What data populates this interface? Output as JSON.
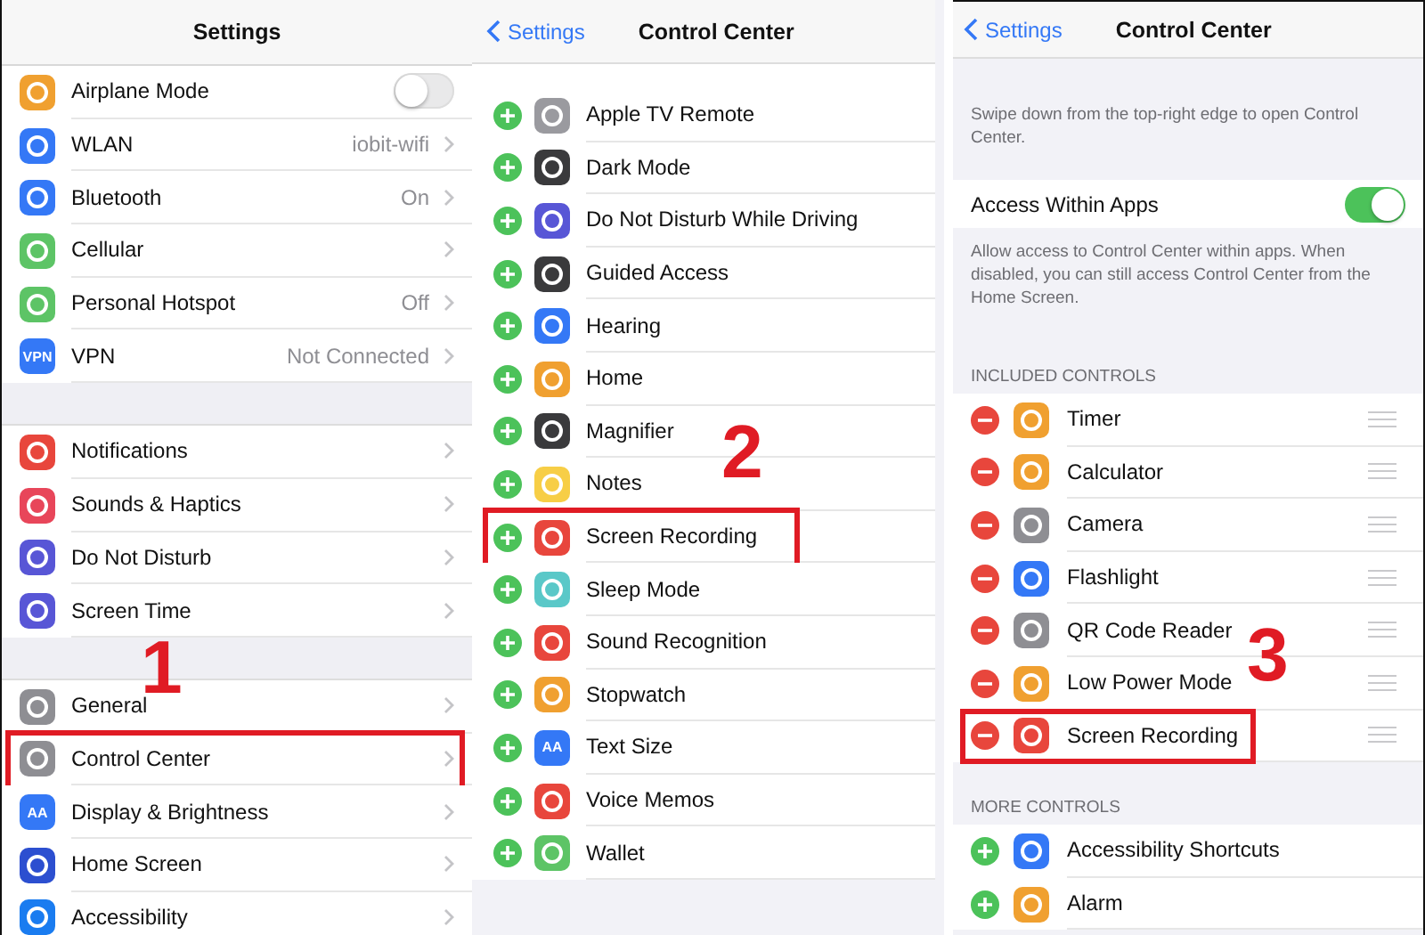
{
  "settings_panel": {
    "title": "Settings",
    "step": "1",
    "groups": [
      [
        {
          "label": "Airplane Mode",
          "kind": "toggle",
          "on": false,
          "color": "#f0a030",
          "highlighted": false
        },
        {
          "label": "WLAN",
          "kind": "link",
          "value": "iobit-wifi",
          "color": "#3478f6",
          "highlighted": false
        },
        {
          "label": "Bluetooth",
          "kind": "link",
          "value": "On",
          "color": "#3478f6",
          "highlighted": false
        },
        {
          "label": "Cellular",
          "kind": "link",
          "color": "#5dc466",
          "highlighted": false
        },
        {
          "label": "Personal Hotspot",
          "kind": "link",
          "value": "Off",
          "color": "#5dc466",
          "highlighted": false
        },
        {
          "label": "VPN",
          "kind": "link",
          "value": "Not Connected",
          "color": "#3478f6",
          "icon_text": "VPN",
          "highlighted": false
        }
      ],
      [
        {
          "label": "Notifications",
          "kind": "link",
          "color": "#e8463c",
          "highlighted": false
        },
        {
          "label": "Sounds & Haptics",
          "kind": "link",
          "color": "#e8465a",
          "highlighted": false
        },
        {
          "label": "Do Not Disturb",
          "kind": "link",
          "color": "#5856d6",
          "highlighted": false
        },
        {
          "label": "Screen Time",
          "kind": "link",
          "color": "#5856d6",
          "highlighted": false
        }
      ],
      [
        {
          "label": "General",
          "kind": "link",
          "color": "#8e8e93",
          "highlighted": false
        },
        {
          "label": "Control Center",
          "kind": "link",
          "color": "#8e8e93",
          "highlighted": true
        },
        {
          "label": "Display & Brightness",
          "kind": "link",
          "color": "#3478f6",
          "icon_text": "AA",
          "highlighted": false
        },
        {
          "label": "Home Screen",
          "kind": "link",
          "color": "#2c4fd0",
          "highlighted": false
        },
        {
          "label": "Accessibility",
          "kind": "link",
          "color": "#1a7cf0",
          "highlighted": false
        }
      ]
    ]
  },
  "more_controls_panel": {
    "back": "Settings",
    "title": "Control Center",
    "step": "2",
    "rows": [
      {
        "label": "Apple TV Remote",
        "color": "#9a9a9f",
        "highlighted": false
      },
      {
        "label": "Dark Mode",
        "color": "#3a3a3c",
        "highlighted": false
      },
      {
        "label": "Do Not Disturb While Driving",
        "color": "#5856d6",
        "highlighted": false
      },
      {
        "label": "Guided Access",
        "color": "#3a3a3c",
        "highlighted": false
      },
      {
        "label": "Hearing",
        "color": "#3478f6",
        "highlighted": false
      },
      {
        "label": "Home",
        "color": "#f0a030",
        "highlighted": false
      },
      {
        "label": "Magnifier",
        "color": "#3a3a3c",
        "highlighted": false
      },
      {
        "label": "Notes",
        "color": "#f7ce46",
        "highlighted": false
      },
      {
        "label": "Screen Recording",
        "color": "#e8463c",
        "highlighted": true
      },
      {
        "label": "Sleep Mode",
        "color": "#5ac8c8",
        "highlighted": false
      },
      {
        "label": "Sound Recognition",
        "color": "#e8463c",
        "highlighted": false
      },
      {
        "label": "Stopwatch",
        "color": "#f0a030",
        "highlighted": false
      },
      {
        "label": "Text Size",
        "color": "#3478f6",
        "icon_text": "AA",
        "highlighted": false
      },
      {
        "label": "Voice Memos",
        "color": "#e8463c",
        "highlighted": false
      },
      {
        "label": "Wallet",
        "color": "#5dc466",
        "highlighted": false
      }
    ]
  },
  "customize_panel": {
    "back": "Settings",
    "title": "Control Center",
    "step": "3",
    "intro": "Swipe down from the top-right edge to open Control Center.",
    "access": {
      "label": "Access Within Apps",
      "on": true
    },
    "access_note": "Allow access to Control Center within apps. When disabled, you can still access Control Center from the Home Screen.",
    "sections": [
      {
        "heading": "INCLUDED CONTROLS",
        "kind": "included",
        "rows": [
          {
            "label": "Timer",
            "color": "#f0a030",
            "highlighted": false
          },
          {
            "label": "Calculator",
            "color": "#f0a030",
            "highlighted": false
          },
          {
            "label": "Camera",
            "color": "#8e8e93",
            "highlighted": false
          },
          {
            "label": "Flashlight",
            "color": "#3478f6",
            "highlighted": false
          },
          {
            "label": "QR Code Reader",
            "color": "#8e8e93",
            "highlighted": false
          },
          {
            "label": "Low Power Mode",
            "color": "#f0a030",
            "highlighted": false
          },
          {
            "label": "Screen Recording",
            "color": "#e8463c",
            "highlighted": true
          }
        ]
      },
      {
        "heading": "MORE CONTROLS",
        "kind": "more",
        "rows": [
          {
            "label": "Accessibility Shortcuts",
            "color": "#3478f6",
            "highlighted": false
          },
          {
            "label": "Alarm",
            "color": "#f0a030",
            "highlighted": false
          }
        ]
      }
    ]
  }
}
